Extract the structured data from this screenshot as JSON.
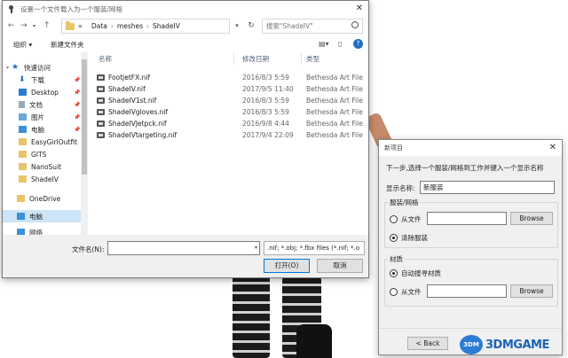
{
  "file_dialog": {
    "title": "设置一个文件载入为一个服装/网格",
    "breadcrumb": [
      "«",
      "Data",
      "meshes",
      "ShadeIV"
    ],
    "search_placeholder": "搜索\"ShadeIV\"",
    "toolbar": {
      "organize": "组织 ▾",
      "new_folder": "新建文件夹"
    },
    "sidebar": [
      {
        "label": "快速访问",
        "icon": "star-icon"
      },
      {
        "label": "下载",
        "icon": "download-icon",
        "pinned": true
      },
      {
        "label": "Desktop",
        "icon": "desktop-icon",
        "pinned": true
      },
      {
        "label": "文档",
        "icon": "document-icon",
        "pinned": true
      },
      {
        "label": "图片",
        "icon": "picture-icon",
        "pinned": true
      },
      {
        "label": "电脑",
        "icon": "computer-icon",
        "pinned": true
      },
      {
        "label": "EasyGirlOutfit",
        "icon": "folder-icon"
      },
      {
        "label": "GITS",
        "icon": "folder-icon"
      },
      {
        "label": "NanoSuit",
        "icon": "folder-icon"
      },
      {
        "label": "ShadeIV",
        "icon": "folder-icon"
      },
      {
        "label": "OneDrive",
        "icon": "cloud-icon"
      },
      {
        "label": "电脑",
        "icon": "computer-icon"
      },
      {
        "label": "网络",
        "icon": "network-icon"
      }
    ],
    "columns": {
      "name": "名称",
      "date": "修改日期",
      "type": "类型"
    },
    "files": [
      {
        "name": "FootjetFX.nif",
        "date": "2016/8/3 5:59",
        "type": "Bethesda Art File"
      },
      {
        "name": "ShadeIV.nif",
        "date": "2017/9/5 11:40",
        "type": "Bethesda Art File"
      },
      {
        "name": "ShadeIV1st.nif",
        "date": "2016/8/3 5:59",
        "type": "Bethesda Art File"
      },
      {
        "name": "ShadeIVgloves.nif",
        "date": "2016/8/3 5:59",
        "type": "Bethesda Art File"
      },
      {
        "name": "ShadeIVJetpck.nif",
        "date": "2016/9/8 4:44",
        "type": "Bethesda Art File"
      },
      {
        "name": "ShadeIVtargeting.nif",
        "date": "2017/9/4 22:09",
        "type": "Bethesda Art File"
      }
    ],
    "filename_label": "文件名(N):",
    "filename_value": "",
    "filetype": ".nif; *.obj; *.fbx files (*.nif; *.o",
    "open_label": "打开(O)",
    "cancel_label": "取消"
  },
  "new_item_dialog": {
    "title": "新项目",
    "instruction": "下一步,选择一个服装/网格到工作并键入一个显示名称",
    "display_name_label": "显示名称:",
    "display_name_value": "新服装",
    "mesh_group": "服装/网格",
    "from_file_label": "从文件",
    "browse_label": "Browse",
    "clear_outfit_label": "清除服装",
    "material_group": "材质",
    "auto_material_label": "自动搜寻材质",
    "material_from_file_label": "从文件",
    "back_label": "< Back"
  },
  "watermark": {
    "logo": "3DM",
    "text": "3DMGAME"
  }
}
